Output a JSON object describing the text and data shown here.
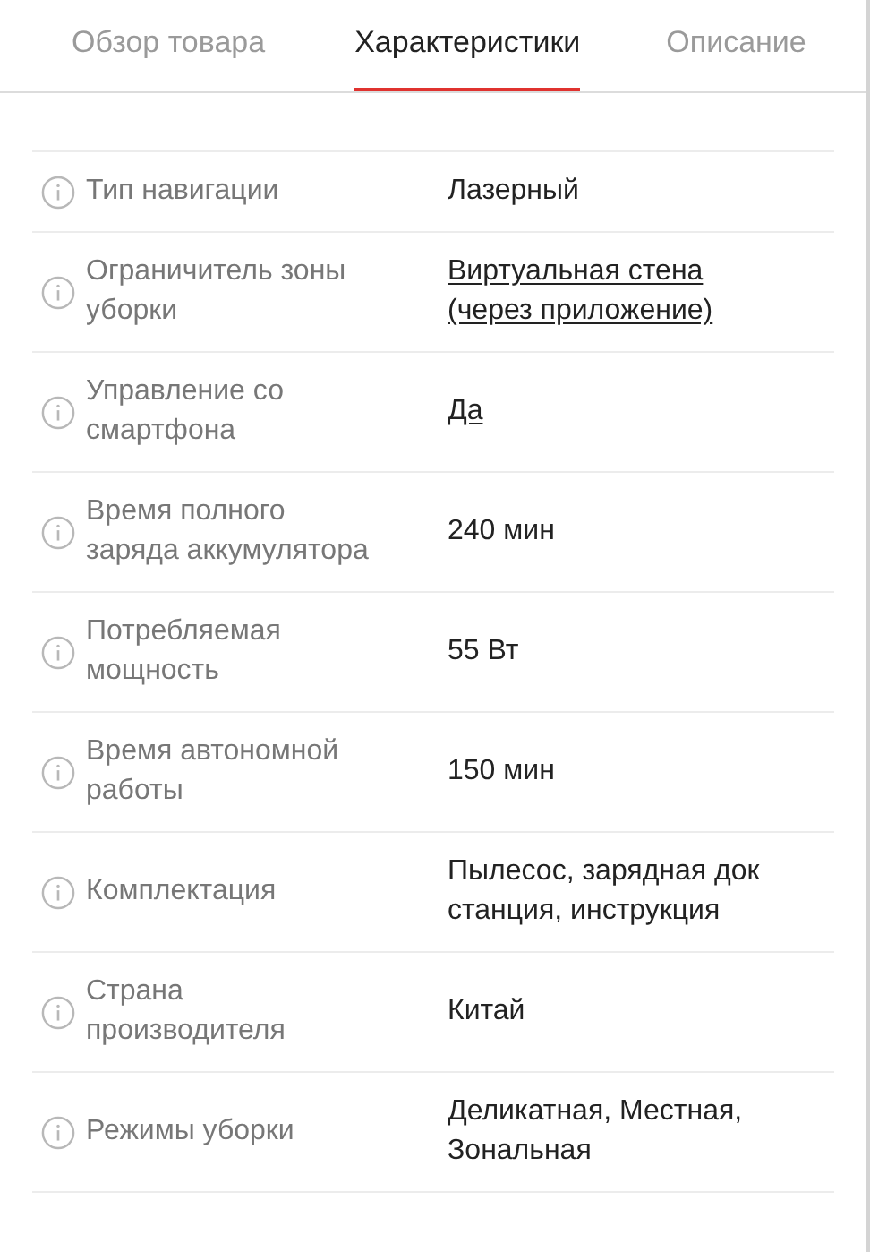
{
  "tabs": [
    {
      "label": "Обзор товара",
      "selected": false
    },
    {
      "label": "Характеристики",
      "selected": true
    },
    {
      "label": "Описание",
      "selected": false
    }
  ],
  "specs": [
    {
      "label": "Тип навигации",
      "value": "Лазерный",
      "kind": "text"
    },
    {
      "label": "Ограничитель зоны\nуборки",
      "value": "Виртуальная стена\n(через приложение)",
      "kind": "link"
    },
    {
      "label": "Управление со\nсмартфона",
      "value": "Да",
      "kind": "link"
    },
    {
      "label": "Время полного\nзаряда аккумулятора",
      "value": "240 мин",
      "kind": "text"
    },
    {
      "label": "Потребляемая\nмощность",
      "value": "55 Вт",
      "kind": "text"
    },
    {
      "label": "Время автономной\nработы",
      "value": "150 мин",
      "kind": "text"
    },
    {
      "label": "Комплектация",
      "value": "Пылесос, зарядная док\nстанция, инструкция",
      "kind": "text"
    },
    {
      "label": "Страна\nпроизводителя",
      "value": "Китай",
      "kind": "text"
    },
    {
      "label": "Режимы уборки",
      "value": "Деликатная, Местная,\nЗональная",
      "kind": "text"
    }
  ]
}
